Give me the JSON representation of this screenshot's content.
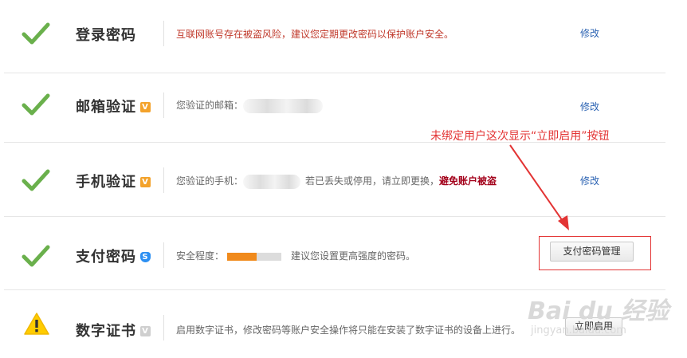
{
  "rows": [
    {
      "title": "登录密码",
      "desc": "互联网账号存在被盗风险，建议您定期更改密码以保护账户安全。",
      "action": "修改"
    },
    {
      "title": "邮箱验证",
      "badge": "V",
      "desc": "您验证的邮箱：",
      "action": "修改"
    },
    {
      "title": "手机验证",
      "badge": "V",
      "desc_prefix": "您验证的手机：",
      "desc_mid": "若已丢失或停用，请立即更换，",
      "desc_highlight": "避免账户被盗",
      "action": "修改"
    },
    {
      "title": "支付密码",
      "badge": "S",
      "desc_prefix": "安全程度：",
      "strength": 0.55,
      "desc_suffix": "建议您设置更高强度的密码。",
      "action": "支付密码管理"
    },
    {
      "title": "数字证书",
      "badge": "V",
      "desc": "启用数字证书，修改密码等账户安全操作将只能在安装了数字证书的设备上进行。",
      "action": "立即启用"
    }
  ],
  "annotation": "未绑定用户这次显示“立即启用”按钮",
  "watermark": {
    "line1": "Bai du 经验",
    "line2": "jingyan.baidu.com"
  },
  "colors": {
    "check": "#6ab04c",
    "warning": "#ffcc00",
    "link": "#2d64b3",
    "annotation": "#e33434"
  }
}
